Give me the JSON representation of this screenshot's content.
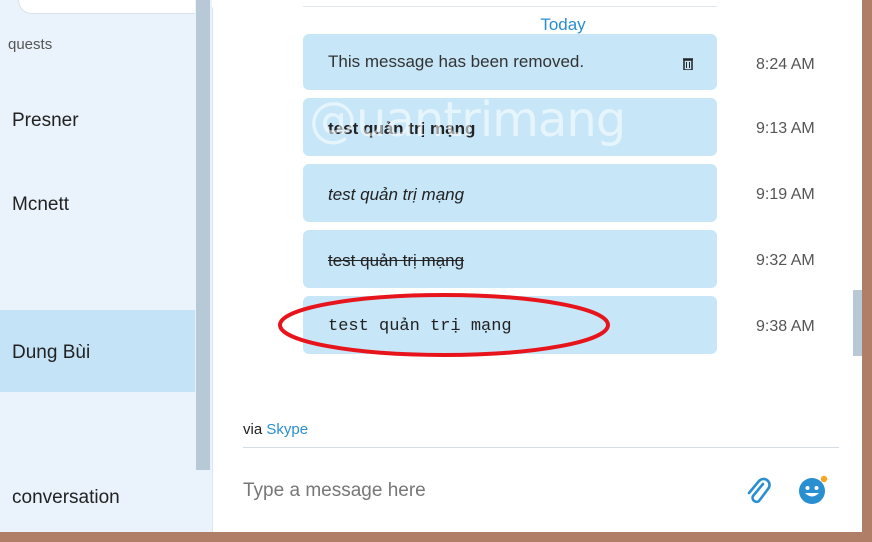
{
  "sidebar": {
    "requests_label": "quests",
    "contacts": [
      {
        "name": "Presner"
      },
      {
        "name": "Mcnett"
      },
      {
        "name": "Dung Bùi"
      },
      {
        "name": "conversation"
      }
    ]
  },
  "chat": {
    "date_divider": "Today",
    "messages": [
      {
        "text": "This message has been removed.",
        "time": "8:24 AM"
      },
      {
        "text": "test quản trị mạng",
        "time": "9:13 AM"
      },
      {
        "text": "test quản trị mạng",
        "time": "9:19 AM"
      },
      {
        "text": "test quản trị mạng",
        "time": "9:32 AM"
      },
      {
        "text": "test quản trị mạng",
        "time": "9:38 AM"
      }
    ],
    "watermark": "@uantrimang",
    "via_prefix": "via",
    "via_service": "Skype",
    "input_placeholder": "Type a message here"
  },
  "colors": {
    "accent": "#2a8fd1",
    "bubble": "#c7e6f8",
    "highlight": "#e8141b",
    "frame": "#b07e66"
  },
  "icons": {
    "trash": "trash-icon",
    "attach": "paperclip-icon",
    "emoji": "emoticon-icon"
  }
}
